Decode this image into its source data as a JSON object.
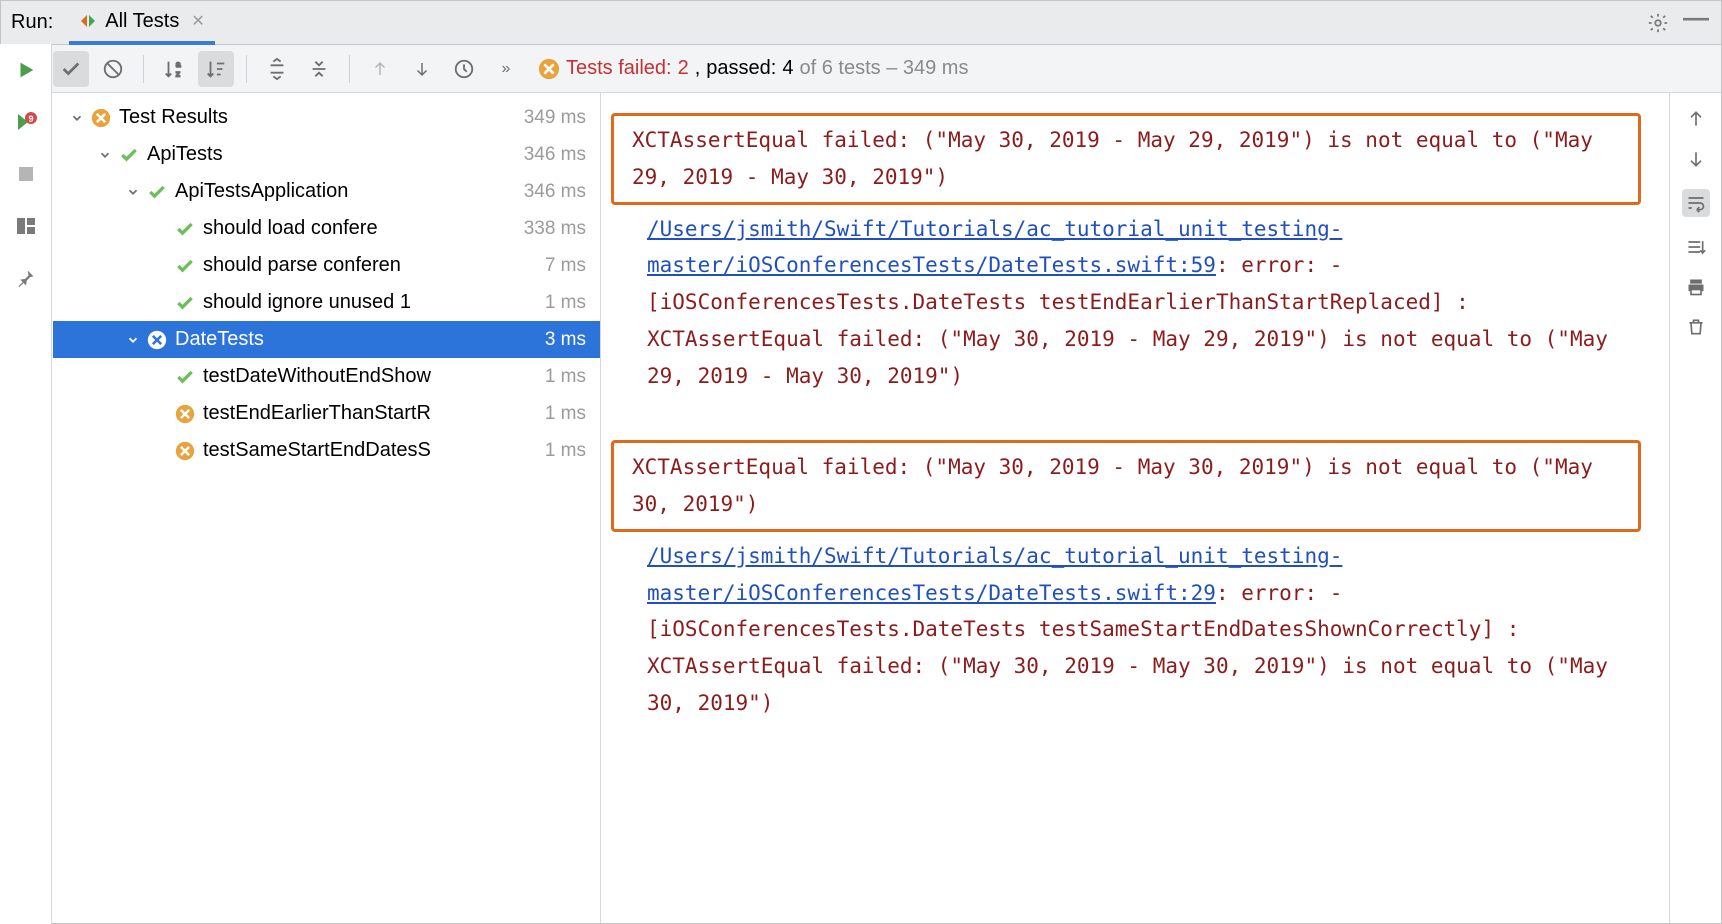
{
  "header": {
    "run_label": "Run:",
    "tab_title": "All Tests"
  },
  "summary": {
    "failed_label": "Tests failed:",
    "failed_count": "2",
    "passed_label": "passed:",
    "passed_count": "4",
    "total_text": "of 6 tests – 349 ms"
  },
  "tree": [
    {
      "indent": 0,
      "chev": true,
      "status": "fail",
      "label": "Test Results",
      "dur": "349 ms"
    },
    {
      "indent": 1,
      "chev": true,
      "status": "pass",
      "label": "ApiTests",
      "dur": "346 ms"
    },
    {
      "indent": 2,
      "chev": true,
      "status": "pass",
      "label": "ApiTestsApplication",
      "dur": "346 ms"
    },
    {
      "indent": 3,
      "chev": false,
      "status": "pass",
      "label": "should load confere",
      "dur": "338 ms"
    },
    {
      "indent": 3,
      "chev": false,
      "status": "pass",
      "label": "should parse conferen",
      "dur": "7 ms"
    },
    {
      "indent": 3,
      "chev": false,
      "status": "pass",
      "label": "should ignore unused 1",
      "dur": "1 ms"
    },
    {
      "indent": 2,
      "chev": true,
      "status": "fail",
      "label": "DateTests",
      "dur": "3 ms",
      "selected": true
    },
    {
      "indent": 3,
      "chev": false,
      "status": "pass",
      "label": "testDateWithoutEndShow",
      "dur": "1 ms"
    },
    {
      "indent": 3,
      "chev": false,
      "status": "fail",
      "label": "testEndEarlierThanStartR",
      "dur": "1 ms"
    },
    {
      "indent": 3,
      "chev": false,
      "status": "fail",
      "label": "testSameStartEndDatesS",
      "dur": "1 ms"
    }
  ],
  "console": {
    "error1": {
      "headline": "XCTAssertEqual failed: (\"May 30, 2019 - May 29, 2019\") is not equal to (\"May 29, 2019 - May 30, 2019\")",
      "path_link": "/Users/jsmith/Swift/Tutorials/ac_tutorial_unit_testing-master/iOSConferencesTests/DateTests.swift:59",
      "tail": ": error: -[iOSConferencesTests.DateTests testEndEarlierThanStartReplaced] : XCTAssertEqual failed: (\"May 30, 2019 - May 29, 2019\") is not equal to (\"May 29, 2019 - May 30, 2019\")"
    },
    "error2": {
      "headline": "XCTAssertEqual failed: (\"May 30, 2019 - May 30, 2019\") is not equal to (\"May 30, 2019\")",
      "path_link": "/Users/jsmith/Swift/Tutorials/ac_tutorial_unit_testing-master/iOSConferencesTests/DateTests.swift:29",
      "tail": ": error: -[iOSConferencesTests.DateTests testSameStartEndDatesShownCorrectly] : XCTAssertEqual failed: (\"May 30, 2019 - May 30, 2019\") is not equal to (\"May 30, 2019\")"
    }
  }
}
